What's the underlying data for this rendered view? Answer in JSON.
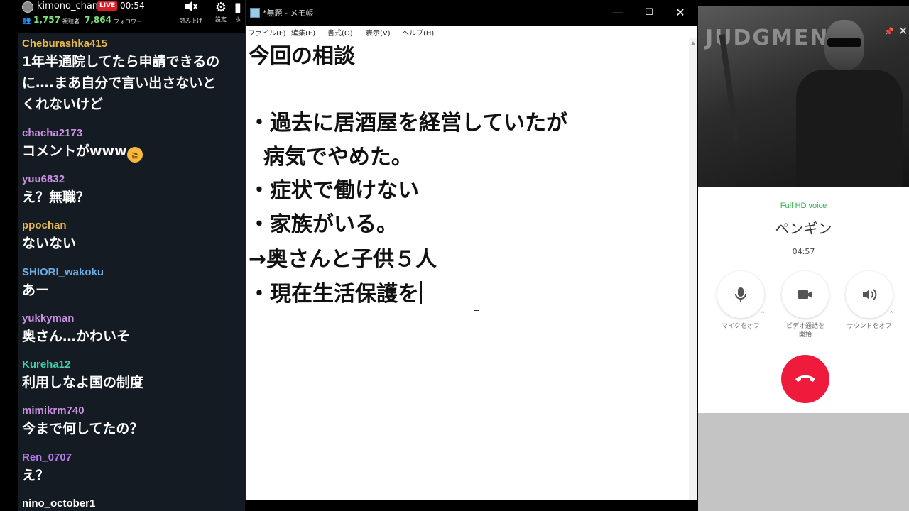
{
  "stream": {
    "channel_name": "kimono_chan",
    "live_badge": "LIVE",
    "elapsed": "00:54",
    "viewers": "1,757",
    "viewers_label": "視聴者",
    "followers": "7,864",
    "followers_label": "フォロワー",
    "buttons": [
      {
        "label": "読み上げ",
        "icon": "speaker-mute-icon"
      },
      {
        "label": "設定",
        "icon": "gear-icon"
      },
      {
        "label": "ホ",
        "icon": "partial-icon"
      }
    ]
  },
  "chat": {
    "messages": [
      {
        "user": "Cheburashka415",
        "color": "#e8b84a",
        "text": "1年半通院してたら申請できるの\nに….まあ自分で言い出さないと\nくれないけど"
      },
      {
        "user": "chacha2173",
        "color": "#c98fe0",
        "text": "コメントがwww",
        "emoji": "laughing-emoji"
      },
      {
        "user": "yuu6832",
        "color": "#c98fe0",
        "text": "え？無職？"
      },
      {
        "user": "ppochan",
        "color": "#e8b84a",
        "text": "ないない"
      },
      {
        "user": "SHIORI_wakoku",
        "color": "#6aaee8",
        "text": "あー"
      },
      {
        "user": "yukkyman",
        "color": "#c98fe0",
        "text": "奥さん…かわいそ"
      },
      {
        "user": "Kureha12",
        "color": "#3fd0a8",
        "text": "利用しなよ国の制度"
      },
      {
        "user": "mimikrm740",
        "color": "#c98fe0",
        "text": "今まで何してたの？"
      },
      {
        "user": "Ren_0707",
        "color": "#b07be8",
        "text": "え？"
      },
      {
        "user": "nino_october1",
        "color": "#ffffff",
        "text": ""
      }
    ]
  },
  "notepad": {
    "title": "*無題 - メモ帳",
    "menu": [
      "ファイル(F)",
      "編集(E)",
      "書式(O)",
      "表示(V)",
      "ヘルプ(H)"
    ],
    "lines": [
      "今回の相談",
      "",
      "・過去に居酒屋を経営していたが",
      "  病気でやめた。",
      "・症状で働けない",
      "・家族がいる。",
      "→奥さんと子供５人",
      "・現在生活保護を"
    ]
  },
  "call": {
    "video_overlay_text": "JUDGMENT",
    "quality": "Full HD voice",
    "contact_name": "ペンギン",
    "duration": "04:57",
    "buttons": [
      {
        "label": "マイクをオフ",
        "icon": "microphone-icon"
      },
      {
        "label": "ビデオ通話を\n開始",
        "icon": "video-camera-icon"
      },
      {
        "label": "サウンドをオフ",
        "icon": "speaker-icon"
      }
    ],
    "hangup_icon": "hang-up-icon",
    "accent_color": "#ee1b3d"
  }
}
